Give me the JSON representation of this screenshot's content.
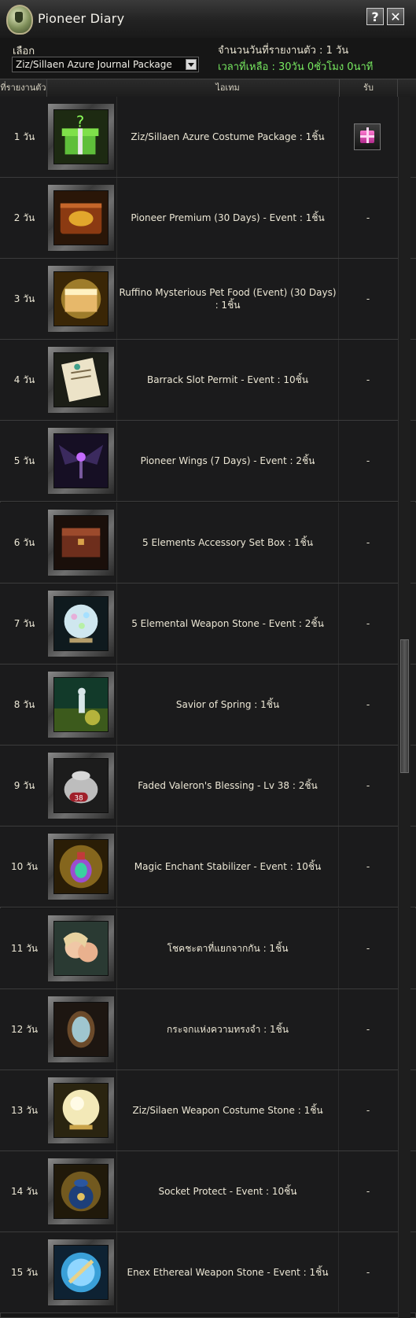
{
  "window": {
    "title": "Pioneer Diary",
    "help_label": "?",
    "close_label": "✕"
  },
  "info": {
    "select_label": "เลือก",
    "dropdown_value": "Ziz/Sillaen Azure Journal Package",
    "days_reported": "จำนวนวันที่รายงานตัว : 1 วัน",
    "time_left": "เวลาที่เหลือ : 30วัน 0ชั่วโมง 0นาที"
  },
  "table": {
    "headers": [
      "ที่รายงานตัว",
      "ไอเทม",
      "รับ"
    ],
    "rows": [
      {
        "day": "1 วัน",
        "icon": "green-gift-box-icon",
        "item": "Ziz/Sillaen Azure Costume Package : 1ชิ้น",
        "claim": "gift"
      },
      {
        "day": "2 วัน",
        "icon": "premium-chest-icon",
        "item": "Pioneer Premium (30 Days) - Event : 1ชิ้น",
        "claim": "-"
      },
      {
        "day": "3 วัน",
        "icon": "mysterious-chest-icon",
        "item": "Ruffino Mysterious Pet Food (Event) (30 Days) : 1ชิ้น",
        "claim": "-"
      },
      {
        "day": "4 วัน",
        "icon": "scroll-permit-icon",
        "item": "Barrack Slot Permit - Event : 10ชิ้น",
        "claim": "-"
      },
      {
        "day": "5 วัน",
        "icon": "dark-wings-icon",
        "item": "Pioneer Wings (7 Days) - Event : 2ชิ้น",
        "claim": "-"
      },
      {
        "day": "6 วัน",
        "icon": "wooden-box-icon",
        "item": "5 Elements Accessory Set Box : 1ชิ้น",
        "claim": "-"
      },
      {
        "day": "7 วัน",
        "icon": "elemental-orb-icon",
        "item": "5 Elemental Weapon Stone - Event : 2ชิ้น",
        "claim": "-"
      },
      {
        "day": "8 วัน",
        "icon": "spring-forest-icon",
        "item": "Savior of Spring : 1ชิ้น",
        "claim": "-"
      },
      {
        "day": "9 วัน",
        "icon": "silver-pouch-icon",
        "item": "Faded Valeron's Blessing - Lv 38 : 2ชิ้น",
        "claim": "-"
      },
      {
        "day": "10 วัน",
        "icon": "rainbow-potion-icon",
        "item": "Magic Enchant Stabilizer - Event : 10ชิ้น",
        "claim": "-"
      },
      {
        "day": "11 วัน",
        "icon": "twin-faces-icon",
        "item": "โชคชะตาที่แยกจากกัน : 1ชิ้น",
        "claim": "-"
      },
      {
        "day": "12 วัน",
        "icon": "magic-mirror-icon",
        "item": "กระจกแห่งความทรงจำ : 1ชิ้น",
        "claim": "-"
      },
      {
        "day": "13 วัน",
        "icon": "golden-orb-icon",
        "item": "Ziz/Silaen Weapon Costume Stone : 1ชิ้น",
        "claim": "-"
      },
      {
        "day": "14 วัน",
        "icon": "blue-pouch-icon",
        "item": "Socket Protect - Event : 10ชิ้น",
        "claim": "-"
      },
      {
        "day": "15 วัน",
        "icon": "ethereal-orb-icon",
        "item": "Enex Ethereal Weapon Stone - Event : 1ชิ้น",
        "claim": "-"
      }
    ]
  },
  "colors": {
    "accent_green": "#77e860",
    "text": "#ece7d5",
    "background": "#161616"
  }
}
